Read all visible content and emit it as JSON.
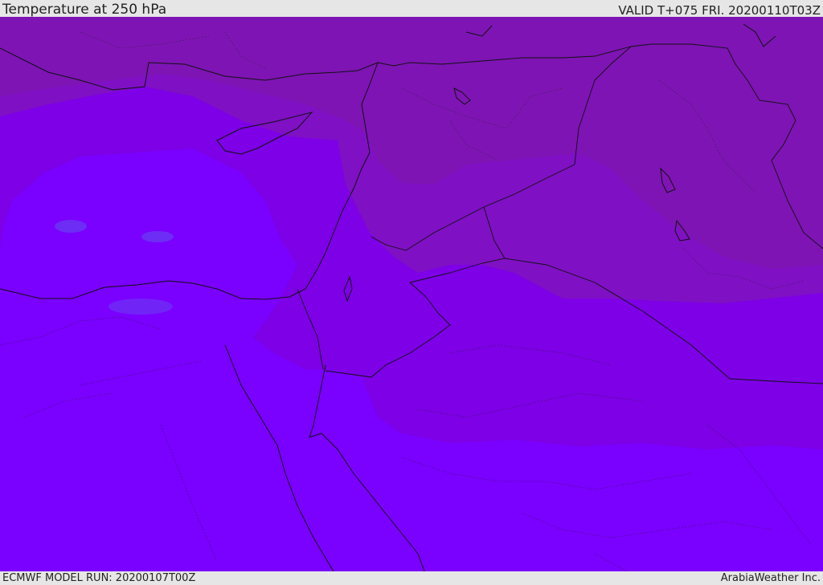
{
  "header": {
    "title": "Temperature at 250 hPa",
    "valid": "VALID T+075 FRI. 20200110T03Z"
  },
  "footer": {
    "model_run": "ECMWF MODEL RUN: 20200107T00Z",
    "credit": "ArabiaWeather Inc."
  },
  "colors": {
    "coldest_band": "#7a00ff",
    "cold_band": "#7d00e6",
    "mid_band": "#7f10c4",
    "warm_band": "#7e14b4",
    "pocket": "#6a3cf0",
    "border": "#111111"
  }
}
